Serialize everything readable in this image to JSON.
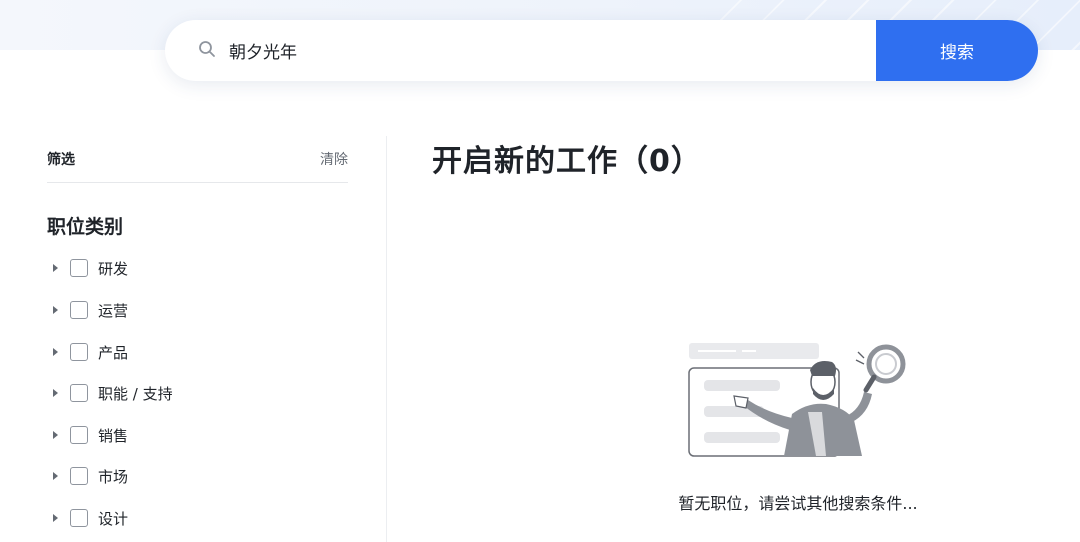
{
  "search": {
    "query": "朝夕光年",
    "button_label": "搜索"
  },
  "filter": {
    "title": "筛选",
    "clear_label": "清除"
  },
  "category": {
    "title": "职位类别",
    "items": [
      {
        "label": "研发"
      },
      {
        "label": "运营"
      },
      {
        "label": "产品"
      },
      {
        "label": "职能 / 支持"
      },
      {
        "label": "销售"
      },
      {
        "label": "市场"
      },
      {
        "label": "设计"
      }
    ]
  },
  "main": {
    "title": "开启新的工作（0）",
    "empty_message": "暂无职位，请尝试其他搜索条件..."
  },
  "colors": {
    "accent": "#2f6ff0",
    "text": "#1f2329",
    "muted": "#646a73"
  },
  "icons": {
    "search": "search-icon",
    "caret": "caret-right-icon"
  }
}
